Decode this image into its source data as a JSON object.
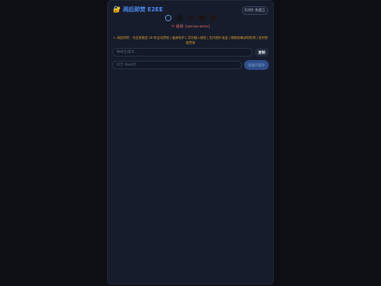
{
  "app": {
    "title": "阅后即焚 E2EE",
    "mode_button": "E2EE 未建立"
  },
  "steps": {
    "count": 5,
    "active_index": 0
  },
  "status": {
    "error_icon": "x-icon",
    "error_text": "错误: [server-error]"
  },
  "notice": {
    "text": "⚠ 阅后即焚：点击查看后 30 秒自动焚毁 | 截屏防护 | 实时输入授权 | 支持图片发送 | 隔绝屏幕录制检测 | 延时智能焚毁"
  },
  "my_id": {
    "placeholder": "等待生成ID...",
    "value": "",
    "copy_label": "复制"
  },
  "peer": {
    "placeholder": "对方 PeerID",
    "value": "",
    "connect_label": "连接并握手"
  },
  "colors": {
    "accent": "#4f8df5",
    "error": "#e06b6b",
    "warning": "#d69d2f",
    "panel": "#161c2b",
    "background": "#0d0f15"
  }
}
